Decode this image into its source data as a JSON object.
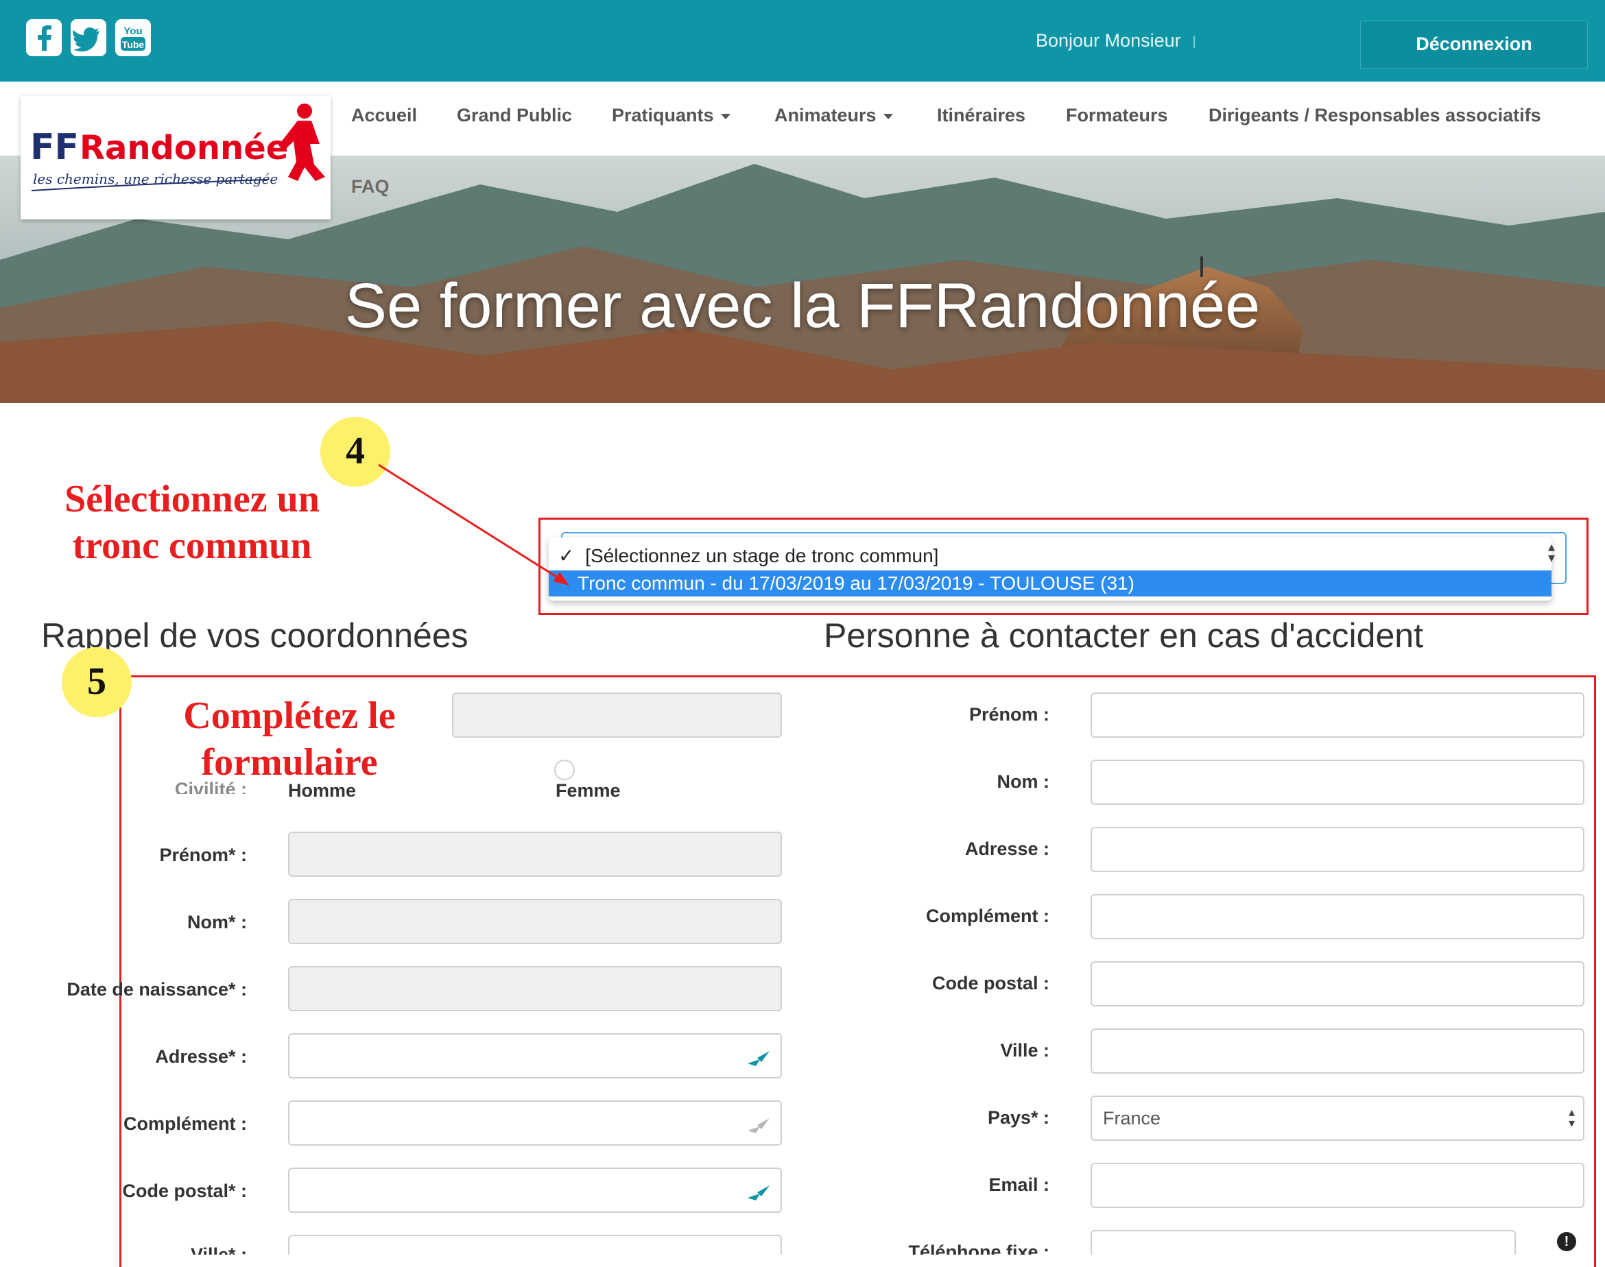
{
  "topbar": {
    "social": [
      {
        "name": "facebook-icon"
      },
      {
        "name": "twitter-icon"
      },
      {
        "name": "youtube-icon",
        "text_top": "You",
        "text_bottom": "Tube"
      }
    ],
    "greeting": "Bonjour Monsieur",
    "logout_label": "Déconnexion"
  },
  "nav": {
    "items": [
      "Accueil",
      "Grand Public",
      "Pratiquants",
      "Animateurs",
      "Itinéraires",
      "Formateurs",
      "Dirigeants / Responsables associatifs"
    ],
    "faq": "FAQ"
  },
  "logo": {
    "brand": "FFRandonnée",
    "tagline": "les chemins, une richesse partagée"
  },
  "hero": {
    "title": "Se former avec la FFRandonnée"
  },
  "annotations": {
    "step4": "4",
    "step4_text_line1": "Sélectionnez un",
    "step4_text_line2": "tronc commun",
    "step5": "5",
    "step5_text_line1": "Complétez le",
    "step5_text_line2": "formulaire"
  },
  "stage_select": {
    "options": [
      "[Sélectionnez un stage de tronc commun]",
      "Tronc commun - du 17/03/2019 au 17/03/2019 - TOULOUSE (31)"
    ],
    "checked_option": "✓"
  },
  "sections": {
    "left_title": "Rappel de vos coordonnées",
    "right_title": "Personne à contacter en cas d'accident"
  },
  "left_form": {
    "civilite_label_partial": "Civilité :",
    "homme": "Homme",
    "femme": "Femme",
    "fields": [
      {
        "label": "Prénom* :",
        "value": ""
      },
      {
        "label": "Nom* :",
        "value": ""
      },
      {
        "label": "Date de naissance* :",
        "value": ""
      },
      {
        "label": "Adresse* :",
        "value": ""
      },
      {
        "label": "Complément :",
        "value": ""
      },
      {
        "label": "Code postal* :",
        "value": ""
      },
      {
        "label": "Ville* :",
        "value": ""
      }
    ]
  },
  "right_form": {
    "fields": [
      {
        "label": "Prénom :",
        "value": ""
      },
      {
        "label": "Nom :",
        "value": ""
      },
      {
        "label": "Adresse :",
        "value": ""
      },
      {
        "label": "Complément :",
        "value": ""
      },
      {
        "label": "Code postal :",
        "value": ""
      },
      {
        "label": "Ville :",
        "value": ""
      },
      {
        "label": "Pays* :",
        "value": "France"
      },
      {
        "label": "Email :",
        "value": ""
      },
      {
        "label": "Téléphone fixe :",
        "value": ""
      }
    ],
    "warning_icon": "!"
  }
}
